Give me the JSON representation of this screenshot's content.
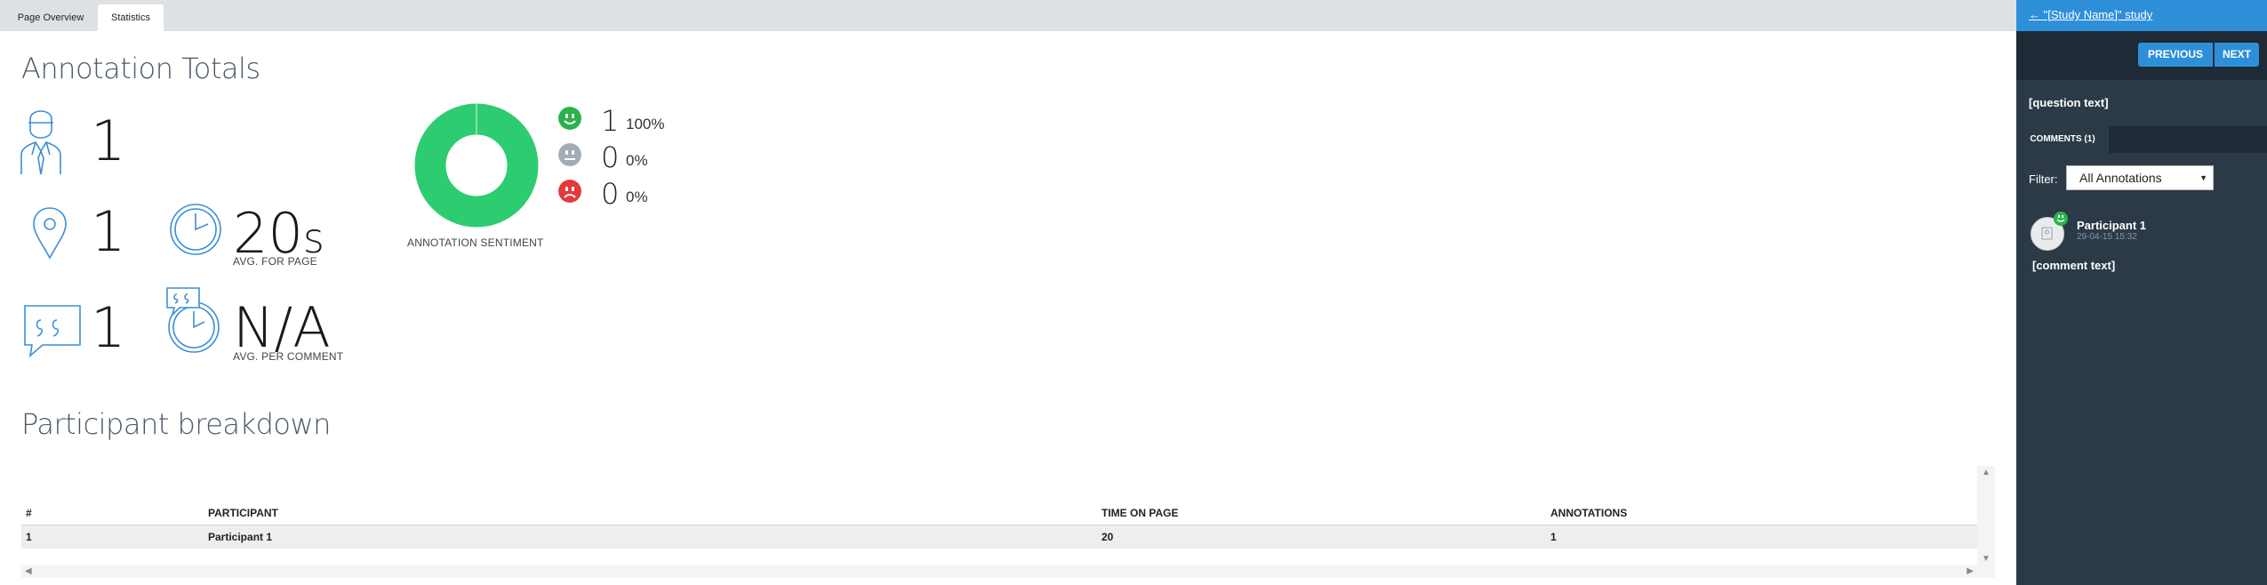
{
  "tabs": [
    {
      "label": "Page Overview"
    },
    {
      "label": "Statistics"
    }
  ],
  "totals": {
    "title": "Annotation Totals",
    "participants": "1",
    "locations": "1",
    "comments": "1",
    "time_per_page": {
      "value": "20",
      "unit": "s",
      "caption": "AVG. FOR PAGE"
    },
    "time_per_comment": {
      "value": "N/A",
      "caption": "AVG. PER COMMENT"
    }
  },
  "sentiment": {
    "caption": "ANNOTATION SENTIMENT",
    "items": [
      {
        "name": "positive",
        "count": "1",
        "percent": "100%",
        "color": "#2bb24c",
        "icon": "smiley-happy-icon"
      },
      {
        "name": "neutral",
        "count": "0",
        "percent": "0%",
        "color": "#a4acb3",
        "icon": "smiley-neutral-icon"
      },
      {
        "name": "negative",
        "count": "0",
        "percent": "0%",
        "color": "#e23b3b",
        "icon": "smiley-sad-icon"
      }
    ],
    "donut_color": "#2ecc71"
  },
  "breakdown": {
    "title": "Participant breakdown",
    "columns": [
      "#",
      "PARTICIPANT",
      "TIME ON PAGE",
      "ANNOTATIONS"
    ],
    "rows": [
      [
        "1",
        "Participant 1",
        "20",
        "1"
      ]
    ]
  },
  "sidebar": {
    "back_label": "← \"[Study Name]\" study",
    "prev_label": "PREVIOUS",
    "next_label": "NEXT",
    "question": "[question text]",
    "comments_tab": "COMMENTS (1)",
    "filter_label": "Filter:",
    "filter_value": "All Annotations",
    "comment": {
      "author": "Participant 1",
      "date": "29-04-15 15:32",
      "text": "[comment text]"
    }
  },
  "colors": {
    "accent": "#2e8fd9",
    "icon_blue": "#3a8fd6",
    "sidebar_bg": "#2c3a48"
  }
}
